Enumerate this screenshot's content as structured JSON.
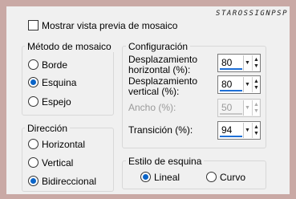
{
  "watermark": "STAROSSIGNPSP",
  "preview": {
    "label": "Mostrar vista previa de mosaico",
    "checked": false
  },
  "tile_method": {
    "title": "Método de mosaico",
    "options": [
      "Borde",
      "Esquina",
      "Espejo"
    ],
    "selected": "Esquina"
  },
  "direction": {
    "title": "Dirección",
    "options": [
      "Horizontal",
      "Vertical",
      "Bidireccional"
    ],
    "selected": "Bidireccional"
  },
  "config": {
    "title": "Configuración",
    "h_offset": {
      "label_line1": "Desplazamiento",
      "label_line2": "horizontal (%):",
      "value": "80"
    },
    "v_offset": {
      "label_line1": "Desplazamiento",
      "label_line2": "vertical (%):",
      "value": "80"
    },
    "width": {
      "label": "Ancho (%):",
      "value": "50",
      "disabled": true
    },
    "transition": {
      "label": "Transición (%):",
      "value": "94"
    }
  },
  "corner_style": {
    "title": "Estilo de esquina",
    "options": [
      "Lineal",
      "Curvo"
    ],
    "selected": "Lineal"
  },
  "colors": {
    "accent": "#0a64c8",
    "background": "#f0f0f0",
    "frame": "#c9a9a5"
  }
}
